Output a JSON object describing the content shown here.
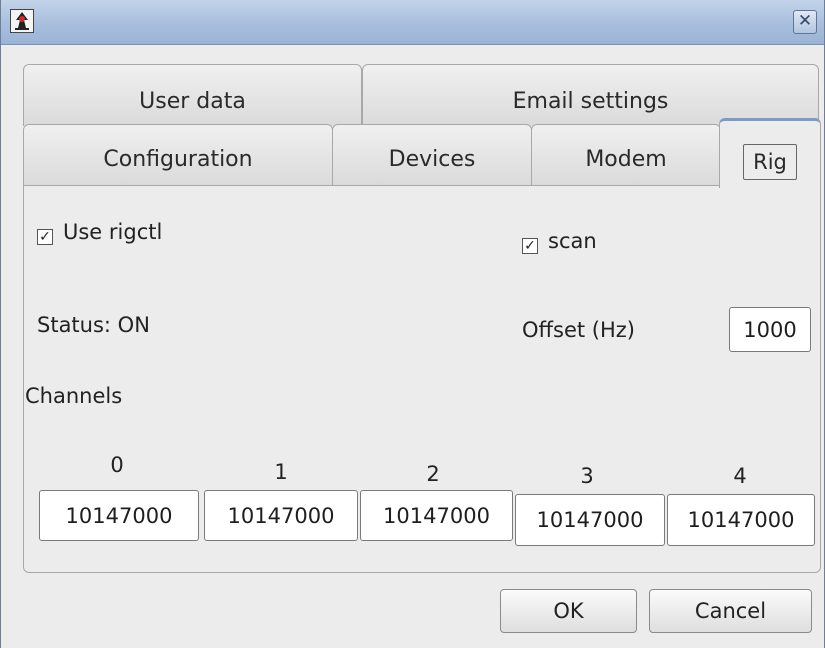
{
  "titlebar": {
    "app_icon": "java-duke-icon",
    "close_glyph": "✕"
  },
  "tabs": {
    "row1": [
      {
        "label": "User data"
      },
      {
        "label": "Email settings"
      }
    ],
    "row2": [
      {
        "label": "Configuration"
      },
      {
        "label": "Devices"
      },
      {
        "label": "Modem"
      },
      {
        "label": "Rig",
        "selected": true
      }
    ]
  },
  "rig": {
    "use_rigctl": {
      "label": "Use rigctl",
      "checked": true
    },
    "scan": {
      "label": "scan",
      "checked": true
    },
    "status": "Status: ON",
    "offset": {
      "label": "Offset (Hz)",
      "value": "1000"
    },
    "channels_label": "Channels",
    "channels": [
      {
        "label": "0",
        "value": "10147000"
      },
      {
        "label": "1",
        "value": "10147000"
      },
      {
        "label": "2",
        "value": "10147000"
      },
      {
        "label": "3",
        "value": "10147000"
      },
      {
        "label": "4",
        "value": "10147000"
      }
    ]
  },
  "buttons": {
    "ok": "OK",
    "cancel": "Cancel"
  },
  "check_glyph": "✓",
  "colors": {
    "titlebar": "#a8bedd",
    "selected_tab_accent": "#7d9bc7",
    "background": "#ececec"
  }
}
